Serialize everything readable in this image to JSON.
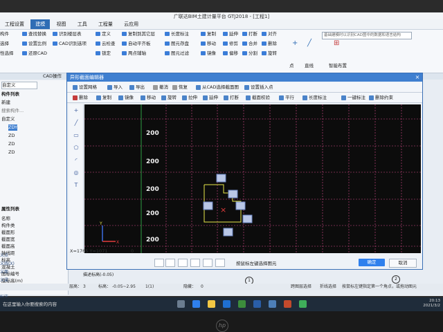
{
  "app": {
    "title": "广联达BIM土建计量平台 GTJ2018 - [工程1]",
    "menus": [
      "工程设置",
      "建模",
      "视图",
      "工具",
      "工程量",
      "云应用"
    ],
    "search_placeholder": "基础建模时以识别CAD图中的数据和语言结构"
  },
  "ribbon": {
    "items": [
      "构件",
      "查找替换",
      "识别楼层表",
      "选择",
      "设置比例",
      "CAD识别选项",
      "性选择",
      "还原CAD",
      "定义",
      "云检查",
      "锁定",
      "复制到其它层",
      "自动平齐板",
      "两点辅轴",
      "长度标注",
      "图元存盘",
      "图元过滤",
      "复制",
      "移动",
      "镜像",
      "延伸",
      "修剪",
      "偏移",
      "打断",
      "合并",
      "分割",
      "对齐",
      "删除",
      "旋转",
      "点",
      "直线",
      "智能布置"
    ],
    "group_label": "CAD操作"
  },
  "left_panel": {
    "filter": "自定义",
    "header": "构件列表",
    "new_label": "新建",
    "search": "搜索构件...",
    "tree_root": "自定义",
    "tree_items": [
      "ZDY",
      "ZD",
      "ZD",
      "ZD"
    ],
    "props_header": "属性列表",
    "props": [
      "名称",
      "构件类",
      "截面形",
      "截面宽",
      "截面高",
      "轴线距",
      "标高",
      "混凝土",
      "图标编号",
      "底标高(m)",
      "备注"
    ],
    "side_items": [
      "义点",
      "义线(X)",
      "义面",
      "义梁",
      "义面",
      "标注(W)"
    ]
  },
  "dialog": {
    "title": "异形截面编辑器",
    "close": "×",
    "toolbar1": [
      "设置网格",
      "导入",
      "导出",
      "撤消",
      "恢复",
      "从CAD选择截面图",
      "设置插入点"
    ],
    "toolbar2": [
      "删除",
      "复制",
      "镜像",
      "移动",
      "旋转",
      "拉伸",
      "延伸",
      "打断",
      "截面校验",
      "平行",
      "长度标注",
      "一键标注",
      "删除约束"
    ],
    "grid_labels": [
      "200",
      "200",
      "200",
      "200",
      "200"
    ],
    "coords": "X=1765 Y=1071",
    "coord_value": "0",
    "hint": "按鼠标左键选择图元",
    "ok": "确定",
    "cancel": "取消"
  },
  "statusbar": {
    "items": [
      "层高：",
      "3",
      "标高：",
      "-0.05~2.95",
      "1(1)",
      "隐藏：",
      "0",
      "跨图层选择",
      "折线选择",
      "按鼠标左键指定第一个角点，或拖动图元"
    ],
    "axis_labels": [
      "1",
      "2"
    ],
    "bottom_note": "描述标高(-0.05)"
  },
  "taskbar": {
    "search": "在这里输入你要搜索的内容",
    "time": "20:13",
    "date": "2021/3/2"
  },
  "colors": {
    "grid_white": "#e6e6e6",
    "grid_pink": "#d84a8c",
    "grid_green": "#2ea043",
    "shape": "#e8e84a",
    "accent": "#2f80ed"
  }
}
